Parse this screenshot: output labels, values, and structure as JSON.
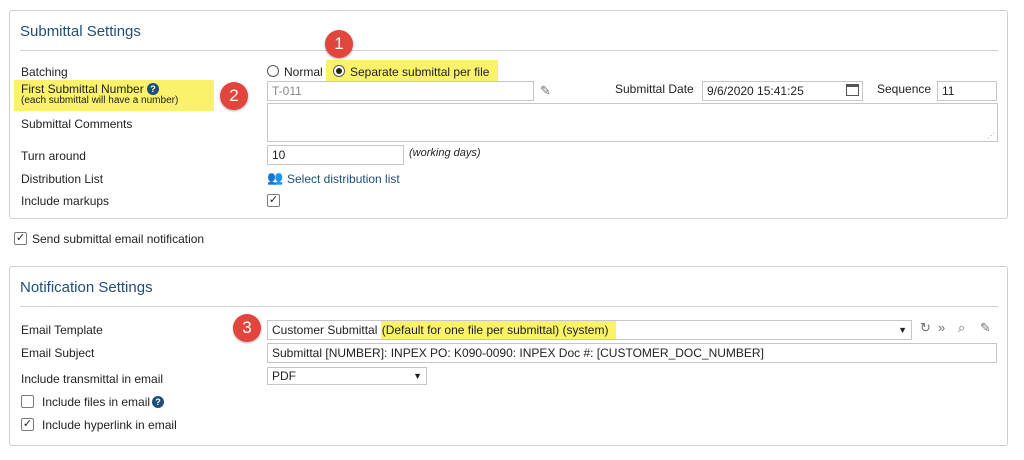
{
  "submittal_settings": {
    "title": "Submittal Settings",
    "batching": {
      "label": "Batching",
      "options": [
        "Normal",
        "Separate submittal per file"
      ],
      "selected": "Separate submittal per file"
    },
    "first_number": {
      "label": "First Submittal Number",
      "sublabel": "(each submittal will have a number)",
      "value": "T-011"
    },
    "submittal_date": {
      "label": "Submittal Date",
      "value": "9/6/2020 15:41:25"
    },
    "sequence": {
      "label": "Sequence",
      "value": "11"
    },
    "comments": {
      "label": "Submittal Comments",
      "value": ""
    },
    "turnaround": {
      "label": "Turn around",
      "value": "10",
      "unit": "(working days)"
    },
    "distribution": {
      "label": "Distribution List",
      "link": "Select distribution list"
    },
    "include_markups": {
      "label": "Include markups",
      "checked": true
    }
  },
  "send_notification": {
    "label": "Send submittal email notification",
    "checked": true
  },
  "notification_settings": {
    "title": "Notification Settings",
    "email_template": {
      "label": "Email Template",
      "value_prefix": "Customer Submittal",
      "value_highlight": "(Default for one file per submittal) (system)"
    },
    "email_subject": {
      "label": "Email Subject",
      "value": "Submittal [NUMBER]: INPEX PO: K090-0090: INPEX Doc #: [CUSTOMER_DOC_NUMBER]"
    },
    "transmittal": {
      "label": "Include transmittal in email",
      "value": "PDF"
    },
    "include_files": {
      "label": "Include files in email",
      "checked": false
    },
    "include_hyperlink": {
      "label": "Include hyperlink in email",
      "checked": true
    }
  },
  "badges": [
    "1",
    "2",
    "3"
  ],
  "colors": {
    "highlight": "#f9f26a",
    "badge": "#e2453b",
    "title": "#1f4e79"
  }
}
